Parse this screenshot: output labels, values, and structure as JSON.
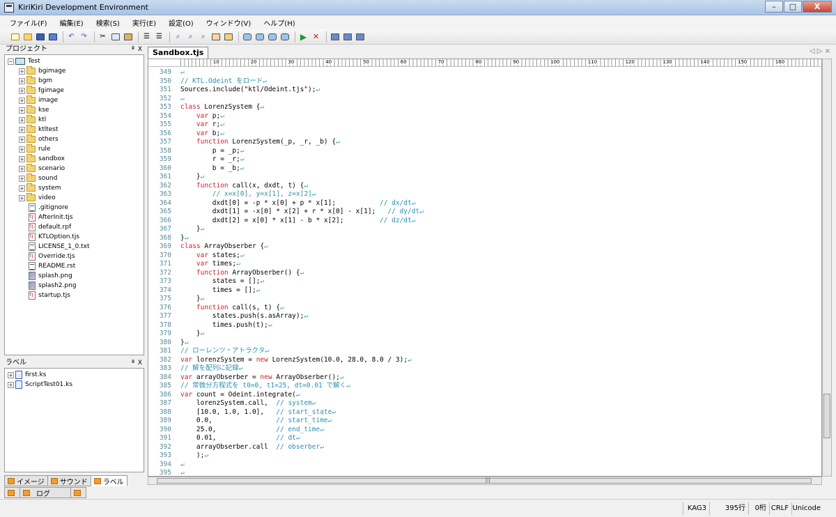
{
  "window": {
    "title": "KiriKiri Development Environment",
    "minimize": "–",
    "maximize": "□",
    "close": "X"
  },
  "menu": [
    "ファイル(F)",
    "編集(E)",
    "検索(S)",
    "実行(E)",
    "設定(O)",
    "ウィンドウ(V)",
    "ヘルプ(H)"
  ],
  "project_panel": {
    "title": "プロジェクト",
    "pin": "ª",
    "close": "X",
    "root": "Test",
    "items": [
      {
        "name": "bgimage",
        "type": "folder"
      },
      {
        "name": "bgm",
        "type": "folder"
      },
      {
        "name": "fgimage",
        "type": "folder"
      },
      {
        "name": "image",
        "type": "folder"
      },
      {
        "name": "kse",
        "type": "folder"
      },
      {
        "name": "ktl",
        "type": "folder"
      },
      {
        "name": "ktltest",
        "type": "folder"
      },
      {
        "name": "others",
        "type": "folder"
      },
      {
        "name": "rule",
        "type": "folder"
      },
      {
        "name": "sandbox",
        "type": "folder"
      },
      {
        "name": "scenario",
        "type": "folder"
      },
      {
        "name": "sound",
        "type": "folder"
      },
      {
        "name": "system",
        "type": "folder"
      },
      {
        "name": "video",
        "type": "folder"
      },
      {
        "name": ".gitignore",
        "type": "txt"
      },
      {
        "name": "AfterInit.tjs",
        "type": "tjs"
      },
      {
        "name": "default.rpf",
        "type": "tjs"
      },
      {
        "name": "KTLOption.tjs",
        "type": "tjs"
      },
      {
        "name": "LICENSE_1_0.txt",
        "type": "txt"
      },
      {
        "name": "Override.tjs",
        "type": "tjs"
      },
      {
        "name": "README.rst",
        "type": "txt"
      },
      {
        "name": "splash.png",
        "type": "img"
      },
      {
        "name": "splash2.png",
        "type": "img"
      },
      {
        "name": "startup.tjs",
        "type": "tjs"
      }
    ]
  },
  "label_panel": {
    "title": "ラベル",
    "pin": "ª",
    "close": "X",
    "items": [
      "first.ks",
      "ScriptTest01.ks"
    ]
  },
  "bottom_tabs": [
    {
      "label": "イメージ",
      "active": false
    },
    {
      "label": "サウンド",
      "active": false
    },
    {
      "label": "ラベル",
      "active": true
    }
  ],
  "log_tabs": [
    "",
    "ログ",
    ""
  ],
  "editor": {
    "tab": "Sandbox.tjs",
    "tab_nav": "◁ ▷ ×",
    "ruler": [
      "10",
      "20",
      "30",
      "40",
      "50",
      "60",
      "70",
      "80",
      "90",
      "100",
      "110",
      "120",
      "130",
      "140",
      "150",
      "160"
    ],
    "lines": [
      {
        "n": "349",
        "t": [
          [
            "nl",
            "↵"
          ]
        ]
      },
      {
        "n": "350",
        "t": [
          [
            "cm",
            "// KTL.Odeint をロード"
          ],
          [
            "nl",
            "↵"
          ]
        ]
      },
      {
        "n": "351",
        "t": [
          [
            "",
            "Sources.include(\"ktl/Odeint.tjs\");"
          ],
          [
            "nl",
            "↵"
          ]
        ]
      },
      {
        "n": "352",
        "t": [
          [
            "nl",
            "↵"
          ]
        ]
      },
      {
        "n": "353",
        "t": [
          [
            "kw",
            "class"
          ],
          [
            "",
            " LorenzSystem {"
          ],
          [
            "nl",
            "↵"
          ]
        ]
      },
      {
        "n": "354",
        "t": [
          [
            "",
            "    "
          ],
          [
            "kw",
            "var"
          ],
          [
            "",
            " p;"
          ],
          [
            "nl",
            "↵"
          ]
        ]
      },
      {
        "n": "355",
        "t": [
          [
            "",
            "    "
          ],
          [
            "kw",
            "var"
          ],
          [
            "",
            " r;"
          ],
          [
            "nl",
            "↵"
          ]
        ]
      },
      {
        "n": "356",
        "t": [
          [
            "",
            "    "
          ],
          [
            "kw",
            "var"
          ],
          [
            "",
            " b;"
          ],
          [
            "nl",
            "↵"
          ]
        ]
      },
      {
        "n": "357",
        "t": [
          [
            "",
            "    "
          ],
          [
            "kw",
            "function"
          ],
          [
            "",
            " LorenzSystem(_p, _r, _b) {"
          ],
          [
            "nl",
            "↵"
          ]
        ]
      },
      {
        "n": "358",
        "t": [
          [
            "",
            "        p = _p;"
          ],
          [
            "nl",
            "↵"
          ]
        ]
      },
      {
        "n": "359",
        "t": [
          [
            "",
            "        r = _r;"
          ],
          [
            "nl",
            "↵"
          ]
        ]
      },
      {
        "n": "360",
        "t": [
          [
            "",
            "        b = _b;"
          ],
          [
            "nl",
            "↵"
          ]
        ]
      },
      {
        "n": "361",
        "t": [
          [
            "",
            "    }"
          ],
          [
            "nl",
            "↵"
          ]
        ]
      },
      {
        "n": "362",
        "t": [
          [
            "",
            "    "
          ],
          [
            "kw",
            "function"
          ],
          [
            "",
            " call(x, dxdt, t) {"
          ],
          [
            "nl",
            "↵"
          ]
        ]
      },
      {
        "n": "363",
        "t": [
          [
            "",
            "        "
          ],
          [
            "cm",
            "// x=x[0], y=x[1], z=x[2]"
          ],
          [
            "nl",
            "↵"
          ]
        ]
      },
      {
        "n": "364",
        "t": [
          [
            "",
            "        dxdt[0] = -p * x[0] + p * x[1];           "
          ],
          [
            "cm",
            "// dx/dt"
          ],
          [
            "nl",
            "↵"
          ]
        ]
      },
      {
        "n": "365",
        "t": [
          [
            "",
            "        dxdt[1] = -x[0] * x[2] + r * x[0] - x[1];   "
          ],
          [
            "cm",
            "// dy/dt"
          ],
          [
            "nl",
            "↵"
          ]
        ]
      },
      {
        "n": "366",
        "t": [
          [
            "",
            "        dxdt[2] = x[0] * x[1] - b * x[2];         "
          ],
          [
            "cm",
            "// dz/dt"
          ],
          [
            "nl",
            "↵"
          ]
        ]
      },
      {
        "n": "367",
        "t": [
          [
            "",
            "    }"
          ],
          [
            "nl",
            "↵"
          ]
        ]
      },
      {
        "n": "368",
        "t": [
          [
            "",
            "}"
          ],
          [
            "nl",
            "↵"
          ]
        ]
      },
      {
        "n": "369",
        "t": [
          [
            "kw",
            "class"
          ],
          [
            "",
            " ArrayObserber {"
          ],
          [
            "nl",
            "↵"
          ]
        ]
      },
      {
        "n": "370",
        "t": [
          [
            "",
            "    "
          ],
          [
            "kw",
            "var"
          ],
          [
            "",
            " states;"
          ],
          [
            "nl",
            "↵"
          ]
        ]
      },
      {
        "n": "371",
        "t": [
          [
            "",
            "    "
          ],
          [
            "kw",
            "var"
          ],
          [
            "",
            " times;"
          ],
          [
            "nl",
            "↵"
          ]
        ]
      },
      {
        "n": "372",
        "t": [
          [
            "",
            "    "
          ],
          [
            "kw",
            "function"
          ],
          [
            "",
            " ArrayObserber() {"
          ],
          [
            "nl",
            "↵"
          ]
        ]
      },
      {
        "n": "373",
        "t": [
          [
            "",
            "        states = [];"
          ],
          [
            "nl",
            "↵"
          ]
        ]
      },
      {
        "n": "374",
        "t": [
          [
            "",
            "        times = [];"
          ],
          [
            "nl",
            "↵"
          ]
        ]
      },
      {
        "n": "375",
        "t": [
          [
            "",
            "    }"
          ],
          [
            "nl",
            "↵"
          ]
        ]
      },
      {
        "n": "376",
        "t": [
          [
            "",
            "    "
          ],
          [
            "kw",
            "function"
          ],
          [
            "",
            " call(s, t) {"
          ],
          [
            "nl",
            "↵"
          ]
        ]
      },
      {
        "n": "377",
        "t": [
          [
            "",
            "        states.push(s.asArray);"
          ],
          [
            "nl",
            "↵"
          ]
        ]
      },
      {
        "n": "378",
        "t": [
          [
            "",
            "        times.push(t);"
          ],
          [
            "nl",
            "↵"
          ]
        ]
      },
      {
        "n": "379",
        "t": [
          [
            "",
            "    }"
          ],
          [
            "nl",
            "↵"
          ]
        ]
      },
      {
        "n": "380",
        "t": [
          [
            "",
            "}"
          ],
          [
            "nl",
            "↵"
          ]
        ]
      },
      {
        "n": "381",
        "t": [
          [
            "cm",
            "// ローレンツ・アトラクタ"
          ],
          [
            "nl",
            "↵"
          ]
        ]
      },
      {
        "n": "382",
        "t": [
          [
            "kw",
            "var"
          ],
          [
            "",
            " lorenzSystem = "
          ],
          [
            "kw",
            "new"
          ],
          [
            "",
            " LorenzSystem(10.0, 28.0, 8.0 / 3);"
          ],
          [
            "nl",
            "↵"
          ]
        ]
      },
      {
        "n": "383",
        "t": [
          [
            "cm",
            "// 解を配列に記録"
          ],
          [
            "nl",
            "↵"
          ]
        ]
      },
      {
        "n": "384",
        "t": [
          [
            "kw",
            "var"
          ],
          [
            "",
            " arrayObserber = "
          ],
          [
            "kw",
            "new"
          ],
          [
            "",
            " ArrayObserber();"
          ],
          [
            "nl",
            "↵"
          ]
        ]
      },
      {
        "n": "385",
        "t": [
          [
            "cm",
            "// 常微分方程式を t0=0, t1=25, dt=0.01 で解く"
          ],
          [
            "nl",
            "↵"
          ]
        ]
      },
      {
        "n": "386",
        "t": [
          [
            "kw",
            "var"
          ],
          [
            "",
            " count = Odeint.integrate("
          ],
          [
            "nl",
            "↵"
          ]
        ]
      },
      {
        "n": "387",
        "t": [
          [
            "",
            "    lorenzSystem.call,  "
          ],
          [
            "cm",
            "// system"
          ],
          [
            "nl",
            "↵"
          ]
        ]
      },
      {
        "n": "388",
        "t": [
          [
            "",
            "    [10.0, 1.0, 1.0],   "
          ],
          [
            "cm",
            "// start_state"
          ],
          [
            "nl",
            "↵"
          ]
        ]
      },
      {
        "n": "389",
        "t": [
          [
            "",
            "    0.0,                "
          ],
          [
            "cm",
            "// start_time"
          ],
          [
            "nl",
            "↵"
          ]
        ]
      },
      {
        "n": "390",
        "t": [
          [
            "",
            "    25.0,               "
          ],
          [
            "cm",
            "// end_time"
          ],
          [
            "nl",
            "↵"
          ]
        ]
      },
      {
        "n": "391",
        "t": [
          [
            "",
            "    0.01,               "
          ],
          [
            "cm",
            "// dt"
          ],
          [
            "nl",
            "↵"
          ]
        ]
      },
      {
        "n": "392",
        "t": [
          [
            "",
            "    arrayObserber.call  "
          ],
          [
            "cm",
            "// obserber"
          ],
          [
            "nl",
            "↵"
          ]
        ]
      },
      {
        "n": "393",
        "t": [
          [
            "",
            "    );"
          ],
          [
            "nl",
            "↵"
          ]
        ]
      },
      {
        "n": "394",
        "t": [
          [
            "nl",
            "↵"
          ]
        ]
      },
      {
        "n": "395",
        "t": [
          [
            "nl",
            "↵"
          ]
        ]
      }
    ]
  },
  "hscroll_grip": "|||",
  "status": {
    "mode": "KAG3",
    "line": "395行",
    "col": "0桁",
    "eol": "CRLF",
    "encoding": "Unicode"
  },
  "colors": {
    "keyword": "#d0202a",
    "comment": "#2a8fb0",
    "line_number": "#5a8a9a"
  }
}
